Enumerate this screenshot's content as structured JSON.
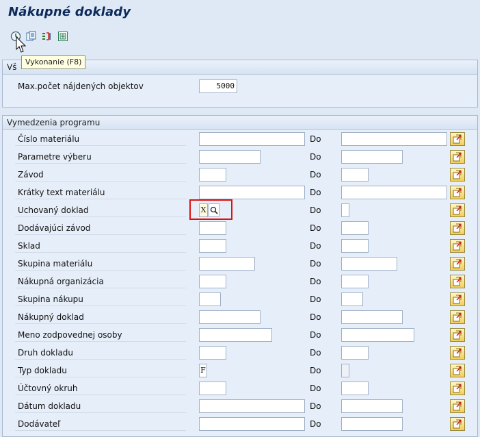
{
  "page": {
    "title": "Nákupné doklady"
  },
  "toolbar": {
    "icons": [
      "execute-icon",
      "get-variant-icon",
      "selection-options-icon",
      "program-documentation-icon"
    ],
    "tooltip": "Vykonanie  (F8)"
  },
  "section1": {
    "title_partial": "Vš",
    "max_label": "Max.počet nájdených objektov",
    "max_value": "5000"
  },
  "section2": {
    "title": "Vymedzenia programu",
    "do_label": "Do",
    "rows": [
      {
        "label": "Číslo materiálu",
        "from": "",
        "to": ""
      },
      {
        "label": "Parametre výberu",
        "from": "",
        "to": ""
      },
      {
        "label": "Závod",
        "from": "",
        "to": ""
      },
      {
        "label": "Krátky text materiálu",
        "from": "",
        "to": ""
      },
      {
        "label": "Uchovaný doklad",
        "from": "X",
        "to": ""
      },
      {
        "label": "Dodávajúci závod",
        "from": "",
        "to": ""
      },
      {
        "label": "Sklad",
        "from": "",
        "to": ""
      },
      {
        "label": "Skupina materiálu",
        "from": "",
        "to": ""
      },
      {
        "label": "Nákupná organizácia",
        "from": "",
        "to": ""
      },
      {
        "label": "Skupina nákupu",
        "from": "",
        "to": ""
      },
      {
        "label": "Nákupný doklad",
        "from": "",
        "to": ""
      },
      {
        "label": "Meno zodpovednej osoby",
        "from": "",
        "to": ""
      },
      {
        "label": "Druh dokladu",
        "from": "",
        "to": ""
      },
      {
        "label": "Typ dokladu",
        "from": "F",
        "to": ""
      },
      {
        "label": "Účtovný okruh",
        "from": "",
        "to": ""
      },
      {
        "label": "Dátum dokladu",
        "from": "",
        "to": ""
      },
      {
        "label": "Dodávateľ",
        "from": "",
        "to": ""
      }
    ]
  },
  "colors": {
    "highlight": "#e01010",
    "background": "#dfe9f5"
  }
}
